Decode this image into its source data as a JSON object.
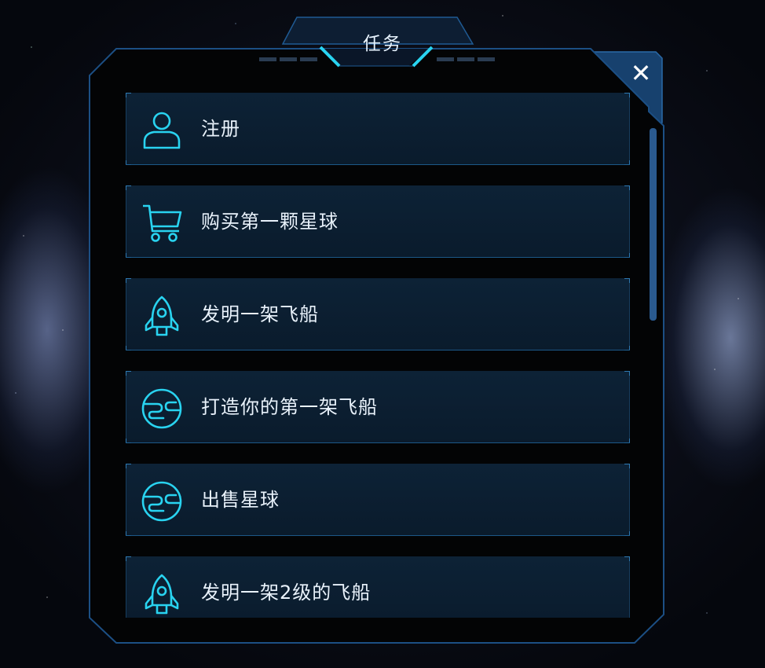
{
  "dialog": {
    "title": "任务",
    "close_label": "✕"
  },
  "tasks": [
    {
      "label": "注册",
      "icon": "user-icon"
    },
    {
      "label": "购买第一颗星球",
      "icon": "cart-icon"
    },
    {
      "label": "发明一架飞船",
      "icon": "rocket-icon"
    },
    {
      "label": "打造你的第一架飞船",
      "icon": "planet-icon"
    },
    {
      "label": "出售星球",
      "icon": "planet-icon"
    },
    {
      "label": "发明一架2级的飞船",
      "icon": "rocket-icon"
    }
  ],
  "colors": {
    "accent": "#29d3f0",
    "frame": "#1b4e83",
    "item_bg": "#0c1f32",
    "text": "#e9f2fb"
  }
}
